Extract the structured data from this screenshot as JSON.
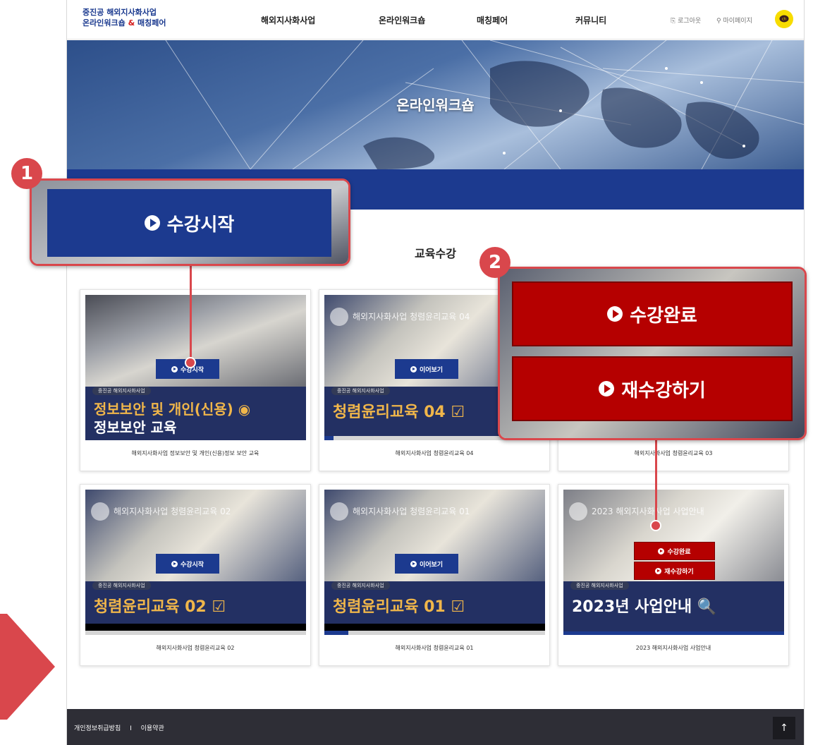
{
  "logo": {
    "line1": "중진공 해외지사화사업",
    "line2_a": "온라인워크숍 ",
    "line2_amp": "&",
    "line2_b": " 매칭페어"
  },
  "nav": [
    "해외지사화사업",
    "온라인워크숍",
    "매칭페어",
    "커뮤니티"
  ],
  "util": {
    "logout": "로그아웃",
    "mypage": "마이페이지"
  },
  "hero": {
    "title": "온라인워크숍"
  },
  "section_title": "교육수강",
  "cards": [
    {
      "tag": "중진공 해외지사화사업",
      "big_line1": "정보보안 및 개인(신용) ◉",
      "big_line2": "정보보안 교육",
      "button": "수강시작",
      "caption": "해외지사화사업 정보보안 및 개인(신용)정보 보안 교육"
    },
    {
      "video_title": "해외지사화사업 청렴윤리교육 04",
      "tag": "중진공 해외지사화사업",
      "big_line1": "청렴윤리교육 04 ☑",
      "button": "이어보기",
      "progress": 0.04,
      "caption": "해외지사화사업 청렴윤리교육 04"
    },
    {
      "caption": "해외지사화사업 청렴윤리교육 03"
    },
    {
      "video_title": "해외지사화사업 청렴윤리교육 02",
      "tag": "중진공 해외지사화사업",
      "big_line1": "청렴윤리교육 02 ☑",
      "button": "수강시작",
      "caption": "해외지사화사업 청렴윤리교육 02"
    },
    {
      "video_title": "해외지사화사업 청렴윤리교육 01",
      "tag": "중진공 해외지사화사업",
      "big_line1": "청렴윤리교육 01 ☑",
      "button": "이어보기",
      "progress": 0.11,
      "caption": "해외지사화사업 청렴윤리교육 01"
    },
    {
      "video_title": "2023 해외지사화사업 사업안내",
      "tag": "중진공 해외지사화사업",
      "big_line1": "2023년 사업안내 🔍",
      "button_complete": "수강완료",
      "button_retake": "재수강하기",
      "caption": "2023 해외지사화사업 사업안내"
    }
  ],
  "callout1": {
    "badge": "1",
    "button": "수강시작"
  },
  "callout2": {
    "badge": "2",
    "button_complete": "수강완료",
    "button_retake": "재수강하기"
  },
  "footer": {
    "privacy": "개인정보취급방침",
    "separator": "I",
    "terms": "이용약관",
    "top_arrow": "↑"
  },
  "colors": {
    "navy": "#1c3a8f",
    "red_button": "#b50000",
    "callout": "#d9474c",
    "footer": "#2e2e36"
  }
}
